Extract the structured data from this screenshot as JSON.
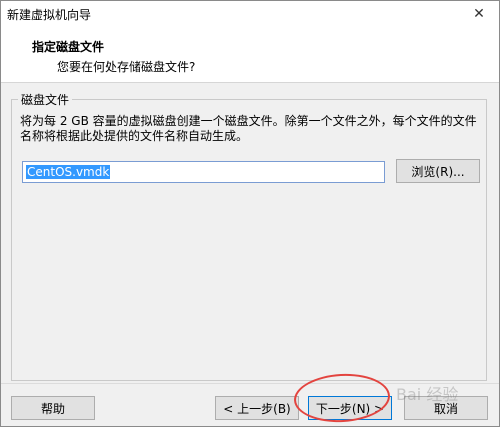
{
  "window": {
    "title": "新建虚拟机向导",
    "close_symbol": "✕"
  },
  "header": {
    "title": "指定磁盘文件",
    "subtitle": "您要在何处存储磁盘文件?"
  },
  "group": {
    "label": "磁盘文件",
    "description": "将为每 2 GB 容量的虚拟磁盘创建一个磁盘文件。除第一个文件之外，每个文件的文件名称将根据此处提供的文件名称自动生成。",
    "filename_value": "CentOS.vmdk",
    "browse_label": "浏览(R)..."
  },
  "buttons": {
    "help": "帮助",
    "back": "< 上一步(B)",
    "next": "下一步(N) >",
    "cancel": "取消"
  },
  "watermark": "Bai 经验",
  "colors": {
    "highlight_circle": "#e3443f",
    "selection": "#3399ff",
    "focus_border": "#0078d7"
  }
}
